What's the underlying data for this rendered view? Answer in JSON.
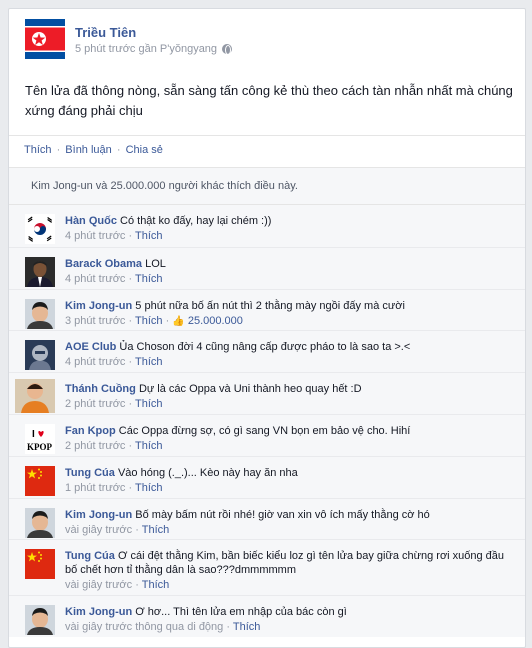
{
  "post": {
    "author": "Triều Tiên",
    "meta": "5 phút trước gần P'yŏngyang",
    "text": "Tên lửa đã thông nòng, sẵn sàng tấn công kẻ thù theo cách tàn nhẫn nhất mà chúng xứng đáng phải chịu"
  },
  "actions": {
    "like": "Thích",
    "comment": "Bình luận",
    "share": "Chia sẻ"
  },
  "likes_text": "Kim Jong-un và 25.000.000 người khác thích điều này.",
  "comments": [
    {
      "name": "Hàn Quốc",
      "text": "Có thật ko đấy, hay lại chém :))",
      "time": "4 phút trước",
      "like": "Thích",
      "avatar": "korea-flag-icon"
    },
    {
      "name": "Barack Obama",
      "text": "LOL",
      "time": "4 phút trước",
      "like": "Thích",
      "avatar": "obama-avatar"
    },
    {
      "name": "Kim Jong-un",
      "text": "5 phút nữa bố ấn nút thì 2 thằng mày ngồi đấy mà cười",
      "time": "3 phút trước",
      "like": "Thích",
      "likes": "25.000.000",
      "avatar": "kim-avatar"
    },
    {
      "name": "AOE Club",
      "text": "Ủa Choson đời 4 cũng nâng cấp được pháo to là sao ta >.<",
      "time": "4 phút trước",
      "like": "Thích",
      "avatar": "aoe-avatar"
    },
    {
      "name": "Thánh Cuồng",
      "text": "Dự là các Oppa và Uni thành heo quay hết :D",
      "time": "2 phút trước",
      "like": "Thích",
      "avatar": "thanh-cuong-avatar"
    },
    {
      "name": "Fan Kpop",
      "text": "Các Oppa đừng sợ, có gì sang VN bọn em bảo vệ cho. Hihí",
      "time": "2 phút trước",
      "like": "Thích",
      "avatar": "kpop-avatar",
      "avatar_label": "I ♥ KPOP"
    },
    {
      "name": "Tung Cúa",
      "text": "Vào hóng (._.)... Kèo này hay ăn nha",
      "time": "1 phút trước",
      "like": "Thích",
      "avatar": "china-flag-icon"
    },
    {
      "name": "Kim Jong-un",
      "text": "Bố mày bấm nút rồi nhé! giờ van xin vô ích mấy thằng cờ hó",
      "time": "vài giây trước",
      "like": "Thích",
      "avatar": "kim-avatar"
    },
    {
      "name": "Tung Cúa",
      "text": "Ơ cái đệt thằng Kim, bần biếc kiểu loz gì tên lửa bay giữa chừng rơi xuống đầu bố chết hơn tỉ thằng dân là sao???dmmmmmm",
      "time": "vài giây trước",
      "like": "Thích",
      "avatar": "china-flag-icon"
    },
    {
      "name": "Kim Jong-un",
      "text": "Ơ hơ... Thì tên lửa em nhập của bác còn gì",
      "time": "vài giây trước thông qua di động",
      "like": "Thích",
      "avatar": "kim-avatar"
    }
  ],
  "colors": {
    "link": "#3b5998",
    "muted": "#9197a3",
    "korea_red": "#c8102e",
    "korea_blue": "#003478",
    "china_red": "#de2910",
    "china_yellow": "#ffde00",
    "nk_red": "#ed1c27",
    "nk_blue": "#024fa2"
  }
}
